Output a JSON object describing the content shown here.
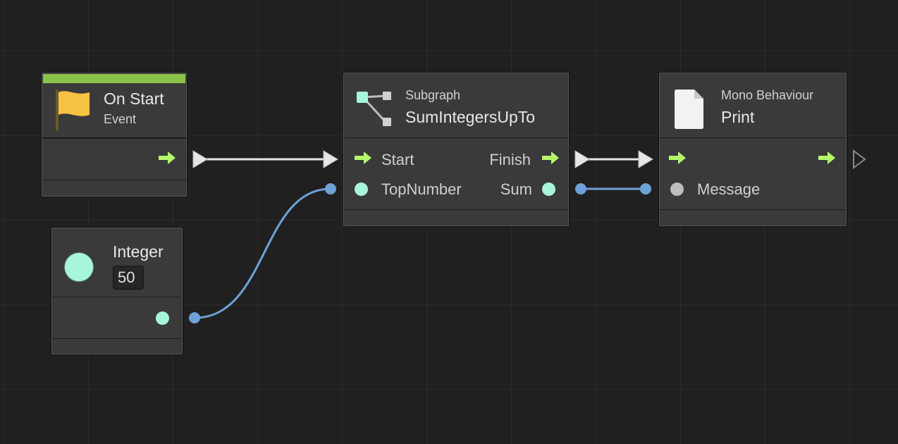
{
  "colors": {
    "background": "#202020",
    "node_body": "#3a3a3a",
    "event_bar": "#8bc34a",
    "flow_arrow": "#b5f76b",
    "integer_port": "#a7f5dc",
    "value_wire": "#6ea1d8",
    "generic_port": "#bdbdbd",
    "flow_wire": "#e6e6e6"
  },
  "nodes": {
    "on_start": {
      "icon": "flag-icon",
      "title": "On Start",
      "subtitle": "Event"
    },
    "integer": {
      "icon": "integer-type-icon",
      "title": "Integer",
      "value": "50"
    },
    "subgraph": {
      "icon": "subgraph-icon",
      "subtitle": "Subgraph",
      "title": "SumIntegersUpTo",
      "inputs": {
        "flow": "Start",
        "value": "TopNumber"
      },
      "outputs": {
        "flow": "Finish",
        "value": "Sum"
      }
    },
    "print": {
      "icon": "document-icon",
      "subtitle": "Mono Behaviour",
      "title": "Print",
      "inputs": {
        "value": "Message"
      }
    }
  }
}
